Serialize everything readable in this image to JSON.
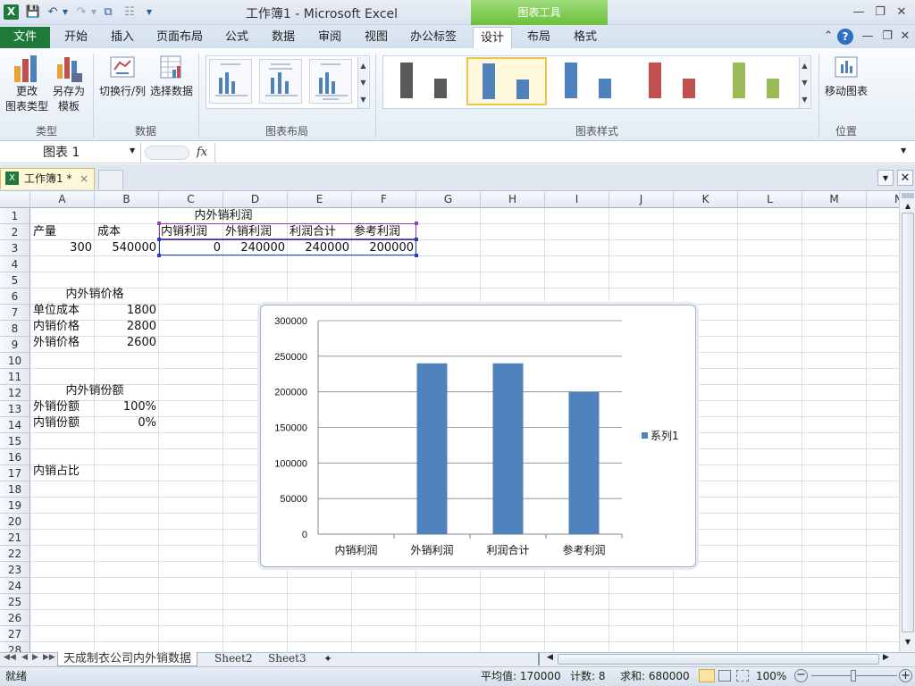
{
  "window": {
    "title": "工作簿1 - Microsoft Excel",
    "app_icon": "X",
    "chart_tools_label": "图表工具"
  },
  "ribbon_tabs": [
    "文件",
    "开始",
    "插入",
    "页面布局",
    "公式",
    "数据",
    "审阅",
    "视图",
    "办公标签",
    "设计",
    "布局",
    "格式"
  ],
  "ribbon": {
    "change_type_line1": "更改",
    "change_type_line2": "图表类型",
    "save_template_line1": "另存为",
    "save_template_line2": "模板",
    "switch_rowcol": "切换行/列",
    "select_data": "选择数据",
    "move_chart": "移动图表",
    "group_type": "类型",
    "group_data": "数据",
    "group_layout": "图表布局",
    "group_styles": "图表样式",
    "group_location": "位置",
    "style_colors": [
      "#595959",
      "#4f81bd",
      "#4f81bd",
      "#c0504d",
      "#9bbb59"
    ]
  },
  "formula_bar": {
    "name_box": "图表 1",
    "fx": "fx",
    "formula": ""
  },
  "workbook_tab": {
    "label": "工作簿1 *",
    "close": "×"
  },
  "columns": [
    "A",
    "B",
    "C",
    "D",
    "E",
    "F",
    "G",
    "H",
    "I",
    "J",
    "K",
    "L",
    "M",
    "N"
  ],
  "rows": [
    "1",
    "2",
    "3",
    "4",
    "5",
    "6",
    "7",
    "8",
    "9",
    "10",
    "11",
    "12",
    "13",
    "14",
    "15",
    "16",
    "17",
    "18",
    "19",
    "20",
    "21",
    "22",
    "23",
    "24",
    "25",
    "26",
    "27",
    "28"
  ],
  "cells": {
    "c1": "内外销利润",
    "a2": "产量",
    "b2": "成本",
    "c2": "内销利润",
    "d2": "外销利润",
    "e2": "利润合计",
    "f2": "参考利润",
    "a3": "300",
    "b3": "540000",
    "c3": "0",
    "d3": "240000",
    "e3": "240000",
    "f3": "200000",
    "a6": "内外销价格",
    "a7": "单位成本",
    "b7": "1800",
    "a8": "内销价格",
    "b8": "2800",
    "a9": "外销价格",
    "b9": "2600",
    "a12": "内外销份额",
    "a13": "外销份额",
    "b13": "100%",
    "a14": "内销份额",
    "b14": "0%",
    "a17": "内销占比"
  },
  "chart_data": {
    "type": "bar",
    "categories": [
      "内销利润",
      "外销利润",
      "利润合计",
      "参考利润"
    ],
    "series": [
      {
        "name": "系列1",
        "values": [
          0,
          240000,
          240000,
          200000
        ],
        "color": "#4f81bd"
      }
    ],
    "ylim": [
      0,
      300000
    ],
    "yticks": [
      "300000",
      "250000",
      "200000",
      "150000",
      "100000",
      "50000",
      "0"
    ],
    "grid": true,
    "legend": "right",
    "title": "",
    "xlabel": "",
    "ylabel": ""
  },
  "sheet_tabs": [
    "天成制衣公司内外销数据",
    "Sheet2",
    "Sheet3"
  ],
  "status": {
    "ready": "就绪",
    "average": "平均值: 170000",
    "count": "计数: 8",
    "sum": "求和: 680000",
    "zoom": "100%"
  }
}
